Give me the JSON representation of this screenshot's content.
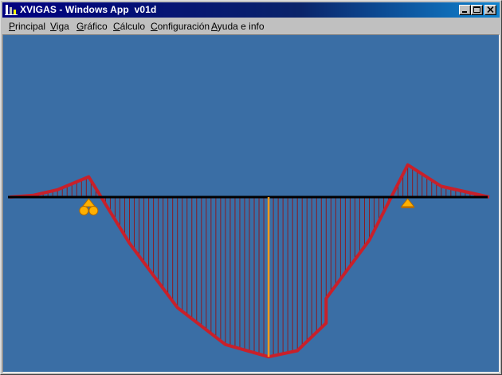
{
  "window": {
    "title": "XVIGAS - Windows App  v01d"
  },
  "titlebar_buttons": [
    {
      "name": "minimize",
      "icon": "minimize-icon"
    },
    {
      "name": "maximize",
      "icon": "maximize-icon"
    },
    {
      "name": "close",
      "icon": "close-icon"
    }
  ],
  "menu": [
    {
      "label": "Principal",
      "accel": "P",
      "rest": "rincipal"
    },
    {
      "label": "Viga",
      "accel": "V",
      "rest": "iga"
    },
    {
      "label": "Gráfico",
      "accel": "G",
      "rest": "ráfico"
    },
    {
      "label": "Cálculo",
      "accel": "C",
      "rest": "álculo"
    },
    {
      "label": "Configuración",
      "accel": "C",
      "rest": "onfiguración"
    },
    {
      "label": "Ayuda e info",
      "accel": "A",
      "rest": "yuda e info"
    }
  ],
  "colors": {
    "canvas_bg": "#3a6ea5",
    "beam": "#000000",
    "diagram": "#c8202a",
    "hatch": "#8b1a20",
    "centerline": "#ff9a1a",
    "support": "#ffb000"
  },
  "diagram": {
    "type": "bending-moment",
    "beam_length": 10,
    "supports": [
      {
        "x": 1.65,
        "type": "roller"
      },
      {
        "x": 8.3,
        "type": "pin"
      }
    ],
    "midline_x": 5.4,
    "moment_profile": [
      {
        "x": 0.0,
        "m": 0.0
      },
      {
        "x": 0.5,
        "m": 0.06
      },
      {
        "x": 1.0,
        "m": 0.24
      },
      {
        "x": 1.65,
        "m": 0.66
      },
      {
        "x": 2.5,
        "m": -1.5
      },
      {
        "x": 3.5,
        "m": -3.6
      },
      {
        "x": 4.5,
        "m": -4.8
      },
      {
        "x": 5.4,
        "m": -5.2
      },
      {
        "x": 6.0,
        "m": -5.0
      },
      {
        "x": 6.6,
        "m": -4.1
      },
      {
        "x": 6.6,
        "m": -3.3
      },
      {
        "x": 7.5,
        "m": -1.4
      },
      {
        "x": 8.3,
        "m": 1.05
      },
      {
        "x": 9.0,
        "m": 0.35
      },
      {
        "x": 10.0,
        "m": 0.0
      }
    ]
  }
}
